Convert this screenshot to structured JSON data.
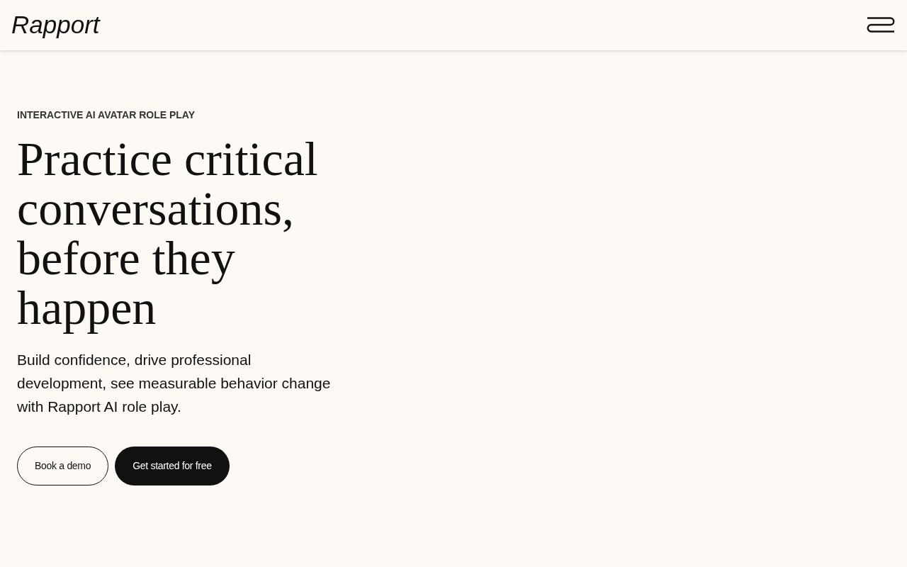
{
  "header": {
    "logo": "Rapport"
  },
  "hero": {
    "eyebrow": "INTERACTIVE AI AVATAR ROLE PLAY",
    "heading": "Practice critical conversations, before they happen",
    "description": "Build confidence, drive professional development, see measurable behavior change with Rapport AI role play.",
    "buttons": [
      {
        "label": "Book a demo",
        "kind": "outline"
      },
      {
        "label": "Get started for free",
        "kind": "filled"
      }
    ]
  }
}
